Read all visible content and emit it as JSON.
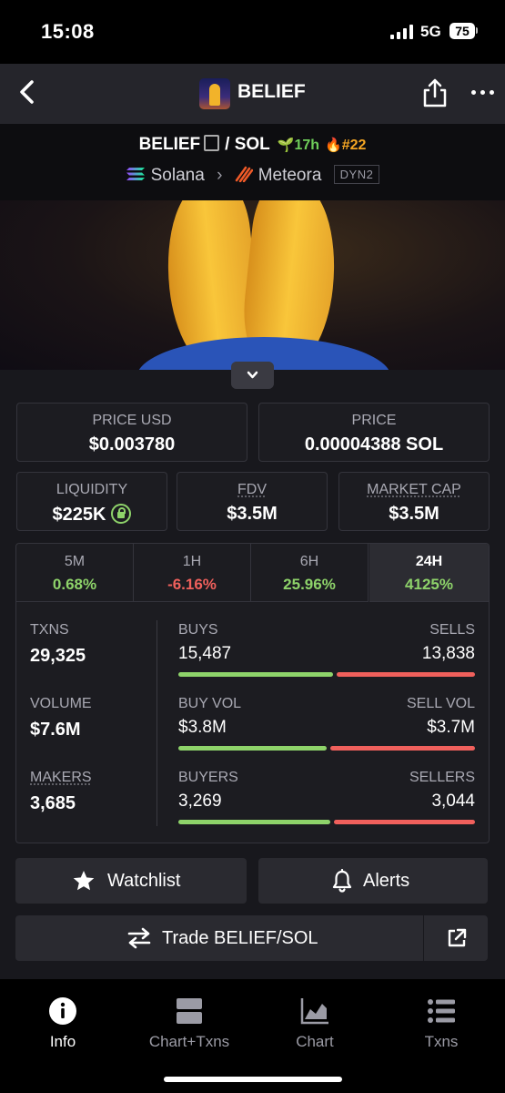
{
  "status_bar": {
    "time": "15:08",
    "network": "5G",
    "battery": "75"
  },
  "nav": {
    "title": "BELIEF"
  },
  "pair": {
    "base": "BELIEF",
    "quote": "/ SOL",
    "age": "17h",
    "rank": "#22",
    "chain": "Solana",
    "dex": "Meteora",
    "dex_badge": "DYN2"
  },
  "price_usd": {
    "label": "PRICE USD",
    "value": "$0.003780"
  },
  "price_native": {
    "label": "PRICE",
    "value": "0.00004388 SOL"
  },
  "liquidity": {
    "label": "LIQUIDITY",
    "value": "$225K"
  },
  "fdv": {
    "label": "FDV",
    "value": "$3.5M"
  },
  "market_cap": {
    "label": "MARKET CAP",
    "value": "$3.5M"
  },
  "timeframes": [
    {
      "label": "5M",
      "value": "0.68%",
      "trend": "up"
    },
    {
      "label": "1H",
      "value": "-6.16%",
      "trend": "down"
    },
    {
      "label": "6H",
      "value": "25.96%",
      "trend": "up"
    },
    {
      "label": "24H",
      "value": "4125%",
      "trend": "up",
      "selected": true
    }
  ],
  "stats": {
    "txns": {
      "label": "TXNS",
      "value": "29,325"
    },
    "volume": {
      "label": "VOLUME",
      "value": "$7.6M"
    },
    "makers": {
      "label": "MAKERS",
      "value": "3,685"
    },
    "buys": {
      "label": "BUYS",
      "value": "15,487",
      "share": 0.528
    },
    "sells": {
      "label": "SELLS",
      "value": "13,838"
    },
    "buy_vol": {
      "label": "BUY VOL",
      "value": "$3.8M",
      "share": 0.507
    },
    "sell_vol": {
      "label": "SELL VOL",
      "value": "$3.7M"
    },
    "buyers": {
      "label": "BUYERS",
      "value": "3,269",
      "share": 0.518
    },
    "sellers": {
      "label": "SELLERS",
      "value": "3,044"
    }
  },
  "actions": {
    "watchlist": "Watchlist",
    "alerts": "Alerts",
    "trade": "Trade BELIEF/SOL"
  },
  "tabbar": {
    "info": "Info",
    "chart_txns": "Chart+Txns",
    "chart": "Chart",
    "txns": "Txns"
  },
  "colors": {
    "positive": "#8ed36a",
    "negative": "#f0605c",
    "accent": "#f5a623"
  }
}
